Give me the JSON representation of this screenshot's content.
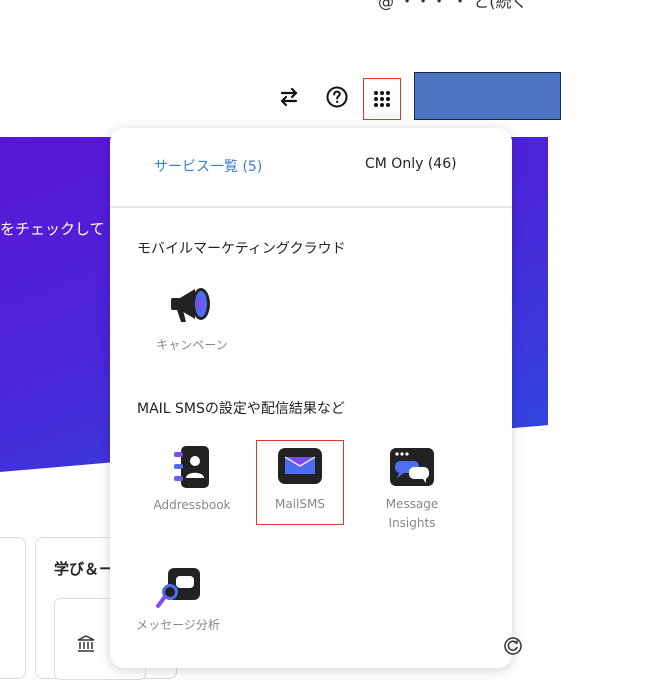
{
  "header": {
    "top_partial_text": "@ ・・・ ・ と(続く",
    "swap_icon": "swap-arrows-icon",
    "help_icon": "help-circle-icon",
    "apps_icon": "apps-grid-icon"
  },
  "background": {
    "hero_text": "をチェックして",
    "card_title": "学び＆ー"
  },
  "panel": {
    "tabs": [
      {
        "label": "サービス一覧 (5)",
        "active": true
      },
      {
        "label": "CM Only (46)",
        "active": false
      }
    ],
    "sections": [
      {
        "title": "モバイルマーケティングクラウド",
        "items": [
          {
            "label": "キャンペーン",
            "icon": "megaphone-icon"
          }
        ]
      },
      {
        "title": "MAIL SMSの設定や配信結果など",
        "items": [
          {
            "label": "Addressbook",
            "icon": "addressbook-icon"
          },
          {
            "label": "MailSMS",
            "icon": "mail-icon"
          },
          {
            "label": "Message Insights",
            "icon": "message-insights-icon"
          },
          {
            "label": "メッセージ分析",
            "icon": "message-analysis-icon"
          }
        ]
      }
    ]
  },
  "colors": {
    "accent": "#3a7bd5",
    "highlight": "#d83a2a",
    "hero_start": "#5a16d6",
    "hero_end": "#2e4ae0",
    "blue_box": "#4f74c2"
  }
}
